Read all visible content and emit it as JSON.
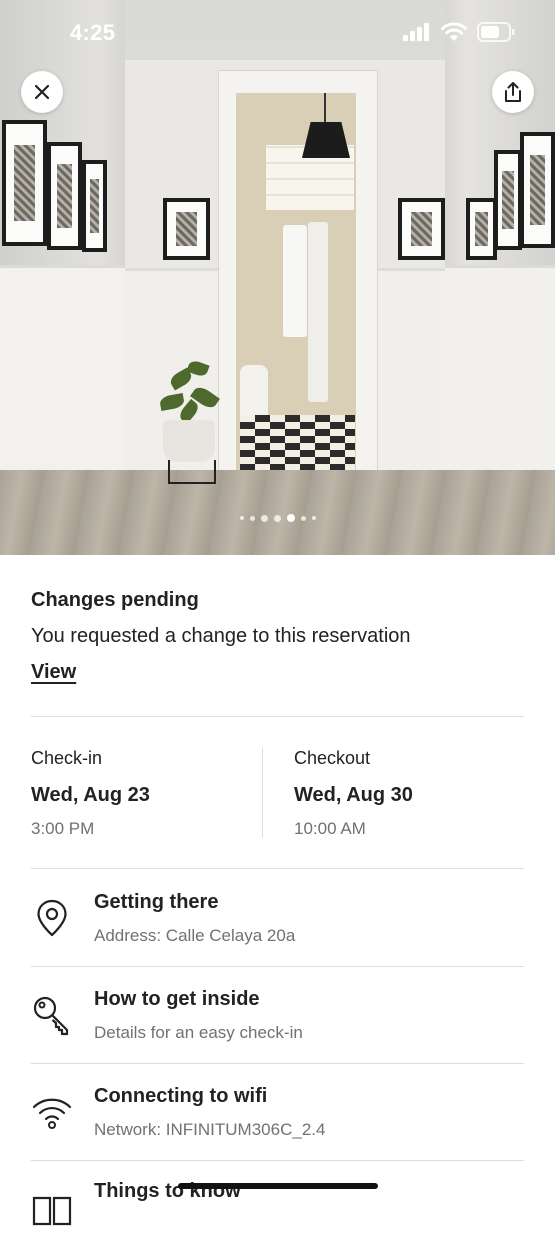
{
  "status_bar": {
    "time": "4:25",
    "icons": [
      "cellular-signal-icon",
      "wifi-icon",
      "battery-icon"
    ]
  },
  "photo_carousel": {
    "description_icons": [
      "close-icon",
      "share-icon"
    ],
    "total_dots": 7,
    "active_dot": 4
  },
  "pending": {
    "title": "Changes pending",
    "text": "You requested a change to this reservation",
    "link": "View"
  },
  "checkin": {
    "label": "Check-in",
    "date": "Wed, Aug 23",
    "time": "3:00 PM"
  },
  "checkout": {
    "label": "Checkout",
    "date": "Wed, Aug 30",
    "time": "10:00 AM"
  },
  "rows": [
    {
      "icon": "map-pin-icon",
      "title": "Getting there",
      "subtitle": "Address: Calle Celaya 20a"
    },
    {
      "icon": "key-icon",
      "title": "How to get inside",
      "subtitle": "Details for an easy check-in"
    },
    {
      "icon": "wifi-icon",
      "title": "Connecting to wifi",
      "subtitle": "Network: INFINITUM306C_2.4"
    },
    {
      "icon": "book-icon",
      "title": "Things to know",
      "subtitle": ""
    }
  ],
  "colors": {
    "text_primary": "#222222",
    "text_secondary": "#717171",
    "divider": "#dddddd"
  }
}
